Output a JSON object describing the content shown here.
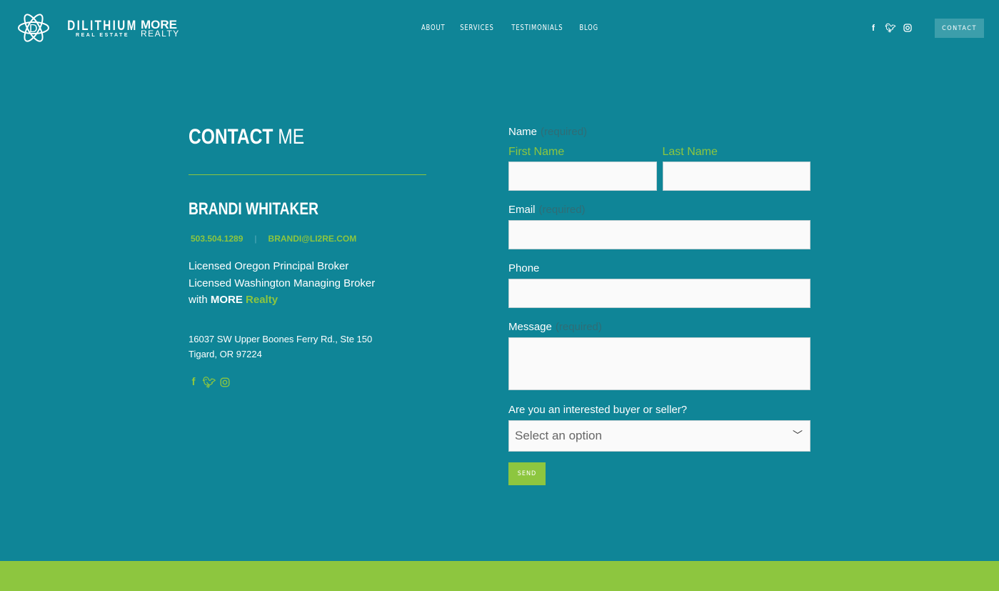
{
  "header": {
    "logo_main": "DILITHIUM",
    "logo_sub": "REAL ESTATE",
    "partner_top": "MORE",
    "partner_bottom": "REALTY",
    "nav": [
      "ABOUT",
      "SERVICES",
      "TESTIMONIALS",
      "BLOG"
    ],
    "social_icons": [
      "facebook-icon",
      "twitter-icon",
      "instagram-icon"
    ],
    "contact_label": "CONTACT"
  },
  "contact": {
    "title_bold": "CONTACT",
    "title_light": "ME",
    "name": "BRANDI WHITAKER",
    "phone": "503.504.1289",
    "separator": "|",
    "email": "BRANDI@LI2RE.COM",
    "license1": "Licensed Oregon Principal Broker",
    "license2": "Licensed Washington Managing Broker",
    "with": "with",
    "more": "MORE",
    "realty": "Realty",
    "address1": "16037 SW Upper Boones Ferry Rd., Ste 150",
    "address2": "Tigard, OR 97224"
  },
  "form": {
    "name_label": "Name",
    "required": "(required)",
    "first_name": "First Name",
    "last_name": "Last Name",
    "email_label": "Email",
    "phone_label": "Phone",
    "message_label": "Message",
    "buyer_label": "Are you an interested buyer or seller?",
    "select_placeholder": "Select an option",
    "send": "SEND"
  },
  "colors": {
    "background": "#0f8597",
    "accent": "#8dc63f"
  }
}
